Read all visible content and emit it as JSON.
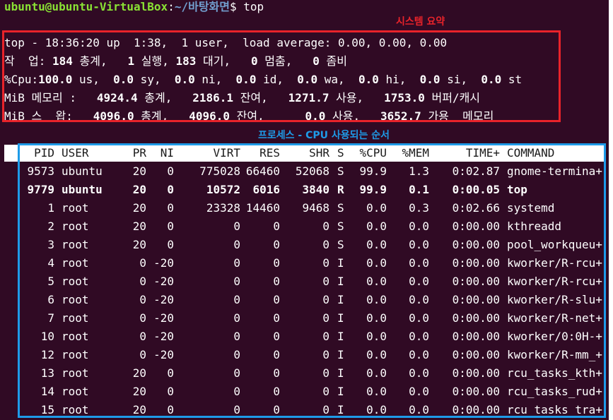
{
  "prompt": {
    "user_host": "ubuntu@ubuntu-VirtualBox",
    "sep": ":",
    "path": "~/바탕화면",
    "symbol": "$ ",
    "command": "top"
  },
  "annotations": {
    "summary_label": "시스템 요약",
    "process_label": "프로세스 - CPU 사용되는 순서",
    "summary_color": "#e8232a",
    "process_color": "#1e9be8"
  },
  "summary": {
    "line1": "top - 18:36:20 up  1:38,  1 user,  load average: 0.00, 0.00, 0.00",
    "tasks": {
      "prefix": "작  업: ",
      "total": "184",
      "t_label": " 총계,   ",
      "running": "1",
      "r_label": " 실행, ",
      "sleeping": "183",
      "s_label": " 대기,   ",
      "stopped": "0",
      "st_label": " 멈춤,   ",
      "zombie": "0",
      "z_label": " 좀비"
    },
    "cpu": {
      "prefix": "%Cpu:",
      "us": "100.0",
      "us_l": " us,  ",
      "sy": "0.0",
      "sy_l": " sy,  ",
      "ni": "0.0",
      "ni_l": " ni,  ",
      "id": "0.0",
      "id_l": " id,  ",
      "wa": "0.0",
      "wa_l": " wa,  ",
      "hi": "0.0",
      "hi_l": " hi,  ",
      "si": "0.0",
      "si_l": " si,  ",
      "st": "0.0",
      "st_l": " st"
    },
    "mem": {
      "prefix": "MiB 메모리 :   ",
      "total": "4924.4",
      "t_l": " 총계,   ",
      "free": "2186.1",
      "f_l": " 잔여,   ",
      "used": "1271.7",
      "u_l": " 사용,   ",
      "buff": "1753.0",
      "b_l": " 버퍼/캐시"
    },
    "swap": {
      "prefix": "MiB 스  왑:   ",
      "total": "4096.0",
      "t_l": " 총계,   ",
      "free": "4096.0",
      "f_l": " 잔여,      ",
      "used": "0.0",
      "u_l": " 사용.   ",
      "avail": "3652.7",
      "a_l": " 가용  메모리"
    }
  },
  "table": {
    "columns": [
      "PID",
      "USER",
      "PR",
      "NI",
      "VIRT",
      "RES",
      "SHR",
      "S",
      "%CPU",
      "%MEM",
      "TIME+",
      "COMMAND"
    ],
    "rows": [
      {
        "pid": "9573",
        "user": "ubuntu",
        "pr": "20",
        "ni": "0",
        "virt": "775028",
        "res": "66460",
        "shr": "52068",
        "s": "S",
        "cpu": "99.9",
        "mem": "1.3",
        "time": "0:02.87",
        "cmd": "gnome-termina+",
        "bold": false
      },
      {
        "pid": "9779",
        "user": "ubuntu",
        "pr": "20",
        "ni": "0",
        "virt": "10572",
        "res": "6016",
        "shr": "3840",
        "s": "R",
        "cpu": "99.9",
        "mem": "0.1",
        "time": "0:00.05",
        "cmd": "top",
        "bold": true
      },
      {
        "pid": "1",
        "user": "root",
        "pr": "20",
        "ni": "0",
        "virt": "23328",
        "res": "14460",
        "shr": "9468",
        "s": "S",
        "cpu": "0.0",
        "mem": "0.3",
        "time": "0:02.66",
        "cmd": "systemd",
        "bold": false
      },
      {
        "pid": "2",
        "user": "root",
        "pr": "20",
        "ni": "0",
        "virt": "0",
        "res": "0",
        "shr": "0",
        "s": "S",
        "cpu": "0.0",
        "mem": "0.0",
        "time": "0:00.00",
        "cmd": "kthreadd",
        "bold": false
      },
      {
        "pid": "3",
        "user": "root",
        "pr": "20",
        "ni": "0",
        "virt": "0",
        "res": "0",
        "shr": "0",
        "s": "S",
        "cpu": "0.0",
        "mem": "0.0",
        "time": "0:00.00",
        "cmd": "pool_workqueu+",
        "bold": false
      },
      {
        "pid": "4",
        "user": "root",
        "pr": "0",
        "ni": "-20",
        "virt": "0",
        "res": "0",
        "shr": "0",
        "s": "I",
        "cpu": "0.0",
        "mem": "0.0",
        "time": "0:00.00",
        "cmd": "kworker/R-rcu+",
        "bold": false
      },
      {
        "pid": "5",
        "user": "root",
        "pr": "0",
        "ni": "-20",
        "virt": "0",
        "res": "0",
        "shr": "0",
        "s": "I",
        "cpu": "0.0",
        "mem": "0.0",
        "time": "0:00.00",
        "cmd": "kworker/R-rcu+",
        "bold": false
      },
      {
        "pid": "6",
        "user": "root",
        "pr": "0",
        "ni": "-20",
        "virt": "0",
        "res": "0",
        "shr": "0",
        "s": "I",
        "cpu": "0.0",
        "mem": "0.0",
        "time": "0:00.00",
        "cmd": "kworker/R-slu+",
        "bold": false
      },
      {
        "pid": "7",
        "user": "root",
        "pr": "0",
        "ni": "-20",
        "virt": "0",
        "res": "0",
        "shr": "0",
        "s": "I",
        "cpu": "0.0",
        "mem": "0.0",
        "time": "0:00.00",
        "cmd": "kworker/R-net+",
        "bold": false
      },
      {
        "pid": "10",
        "user": "root",
        "pr": "0",
        "ni": "-20",
        "virt": "0",
        "res": "0",
        "shr": "0",
        "s": "I",
        "cpu": "0.0",
        "mem": "0.0",
        "time": "0:00.00",
        "cmd": "kworker/0:0H-+",
        "bold": false
      },
      {
        "pid": "12",
        "user": "root",
        "pr": "0",
        "ni": "-20",
        "virt": "0",
        "res": "0",
        "shr": "0",
        "s": "I",
        "cpu": "0.0",
        "mem": "0.0",
        "time": "0:00.00",
        "cmd": "kworker/R-mm_+",
        "bold": false
      },
      {
        "pid": "13",
        "user": "root",
        "pr": "20",
        "ni": "0",
        "virt": "0",
        "res": "0",
        "shr": "0",
        "s": "I",
        "cpu": "0.0",
        "mem": "0.0",
        "time": "0:00.00",
        "cmd": "rcu_tasks_kth+",
        "bold": false
      },
      {
        "pid": "14",
        "user": "root",
        "pr": "20",
        "ni": "0",
        "virt": "0",
        "res": "0",
        "shr": "0",
        "s": "I",
        "cpu": "0.0",
        "mem": "0.0",
        "time": "0:00.00",
        "cmd": "rcu_tasks_rud+",
        "bold": false
      },
      {
        "pid": "15",
        "user": "root",
        "pr": "20",
        "ni": "0",
        "virt": "0",
        "res": "0",
        "shr": "0",
        "s": "I",
        "cpu": "0.0",
        "mem": "0.0",
        "time": "0:00.00",
        "cmd": "rcu_tasks_tra+",
        "bold": false
      }
    ]
  }
}
